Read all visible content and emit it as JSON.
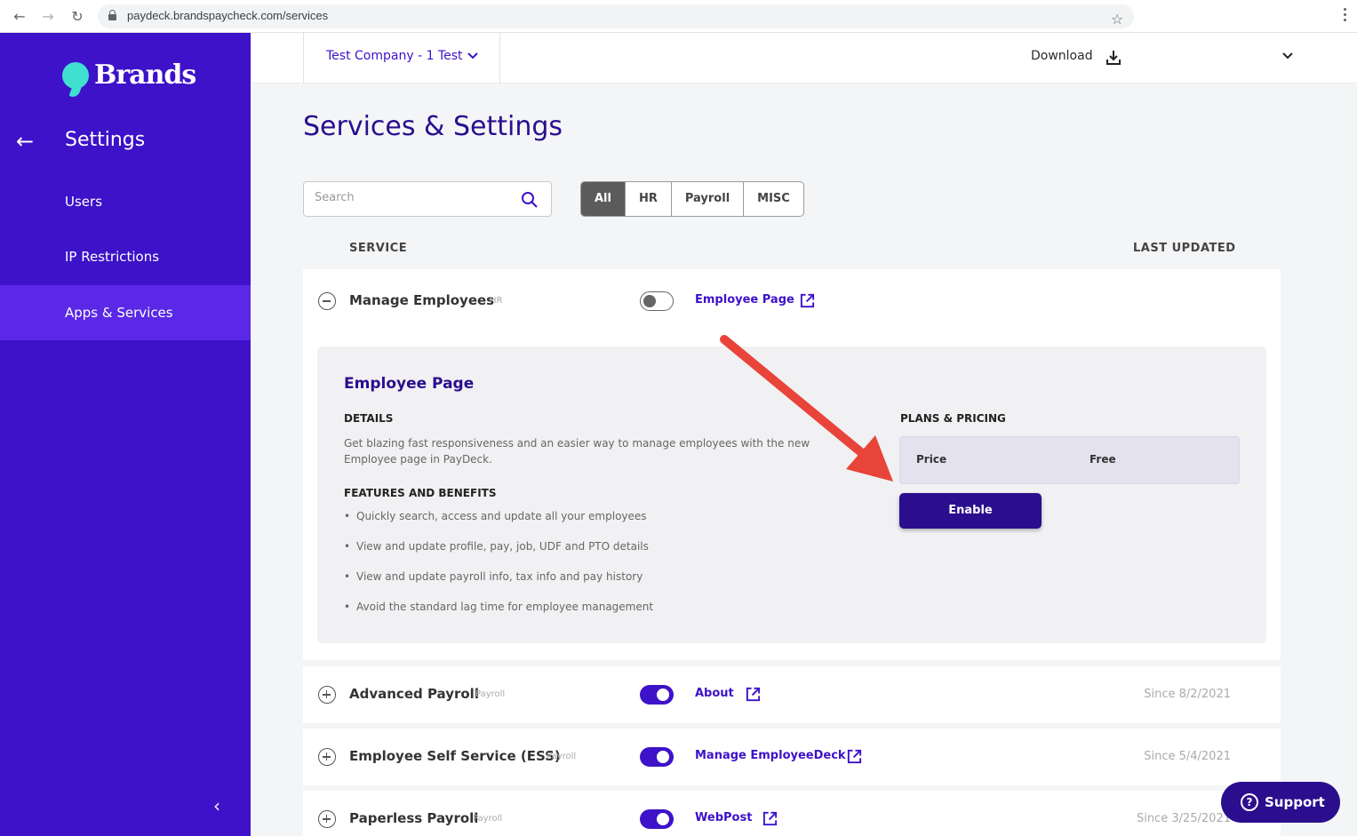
{
  "browser": {
    "url": "paydeck.brandspaycheck.com/services"
  },
  "sidebar": {
    "logo_text": "Brands",
    "title": "Settings",
    "items": [
      {
        "label": "Users"
      },
      {
        "label": "IP Restrictions"
      },
      {
        "label": "Apps & Services",
        "active": true
      }
    ]
  },
  "header": {
    "company": "Test Company - 1 Test",
    "download_label": "Download"
  },
  "main": {
    "title": "Services & Settings",
    "search_placeholder": "Search",
    "filters": [
      {
        "label": "All",
        "active": true
      },
      {
        "label": "HR"
      },
      {
        "label": "Payroll"
      },
      {
        "label": "MISC"
      }
    ],
    "columns": {
      "service": "SERVICE",
      "last_updated": "LAST UPDATED"
    }
  },
  "services": [
    {
      "name": "Manage Employees",
      "tag": "HR",
      "enabled": false,
      "link": "Employee Page",
      "date": "",
      "expanded": true
    },
    {
      "name": "Advanced Payroll",
      "tag": "Payroll",
      "enabled": true,
      "link": "About",
      "date": "Since 8/2/2021"
    },
    {
      "name": "Employee Self Service (ESS)",
      "tag": "Payroll",
      "enabled": true,
      "link": "Manage EmployeeDeck",
      "date": "Since 5/4/2021"
    },
    {
      "name": "Paperless Payroll",
      "tag": "Payroll",
      "enabled": true,
      "link": "WebPost",
      "date": "Since 3/25/2021"
    }
  ],
  "detail": {
    "title": "Employee Page",
    "details_heading": "DETAILS",
    "details_text": "Get blazing fast responsiveness and an easier way to manage employees with the new Employee page in PayDeck.",
    "features_heading": "FEATURES AND BENEFITS",
    "features": [
      "Quickly search, access and update all your employees",
      "View and update profile, pay, job, UDF and PTO details",
      "View and update payroll info, tax info and pay history",
      "Avoid the standard lag time for employee management"
    ],
    "plans_heading": "PLANS & PRICING",
    "price_label": "Price",
    "price_value": "Free",
    "enable_label": "Enable"
  },
  "support": {
    "label": "Support"
  },
  "colors": {
    "sidebar": "#3d12c9",
    "sidebar_active": "#5a28e6",
    "accent": "#2a0e8e",
    "annotation_arrow": "#e8443a"
  }
}
